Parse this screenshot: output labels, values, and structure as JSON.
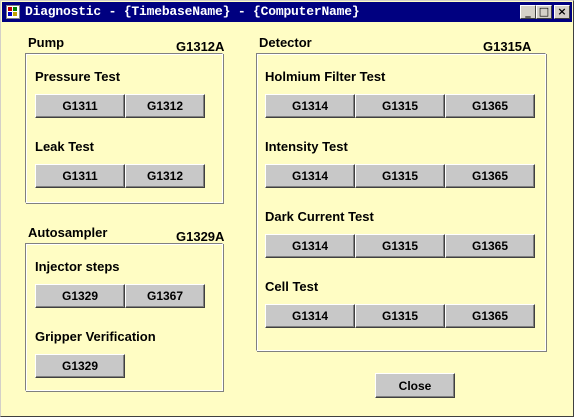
{
  "window": {
    "title": "Diagnostic - {TimebaseName} - {ComputerName}",
    "controls": {
      "minimize": "_",
      "maximize": "□",
      "close": "×"
    }
  },
  "pump": {
    "label": "Pump",
    "model": "G1312A",
    "tests": [
      {
        "label": "Pressure Test",
        "buttons": [
          "G1311",
          "G1312"
        ]
      },
      {
        "label": "Leak Test",
        "buttons": [
          "G1311",
          "G1312"
        ]
      }
    ]
  },
  "autosampler": {
    "label": "Autosampler",
    "model": "G1329A",
    "tests": [
      {
        "label": "Injector steps",
        "buttons": [
          "G1329",
          "G1367"
        ]
      },
      {
        "label": "Gripper Verification",
        "buttons": [
          "G1329"
        ]
      }
    ]
  },
  "detector": {
    "label": "Detector",
    "model": "G1315A",
    "tests": [
      {
        "label": "Holmium Filter Test",
        "buttons": [
          "G1314",
          "G1315",
          "G1365"
        ]
      },
      {
        "label": "Intensity Test",
        "buttons": [
          "G1314",
          "G1315",
          "G1365"
        ]
      },
      {
        "label": "Dark Current Test",
        "buttons": [
          "G1314",
          "G1315",
          "G1365"
        ]
      },
      {
        "label": "Cell Test",
        "buttons": [
          "G1314",
          "G1315",
          "G1365"
        ]
      }
    ]
  },
  "footer": {
    "close_label": "Close"
  }
}
